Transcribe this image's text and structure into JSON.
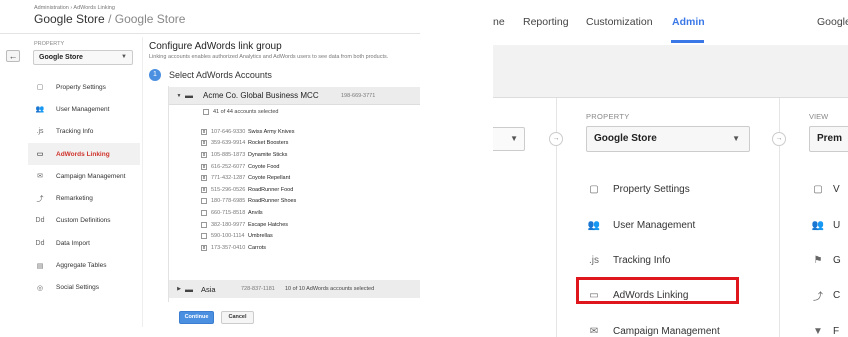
{
  "left": {
    "breadcrumb": "Administration › AdWords Linking",
    "title_main": "Google Store",
    "title_sub": "/ Google Store",
    "back_icon": "←",
    "property_label": "PROPERTY",
    "property_value": "Google Store",
    "nav": [
      {
        "label": "Property Settings",
        "icon": "▢"
      },
      {
        "label": "User Management",
        "icon": "👥"
      },
      {
        "label": "Tracking Info",
        "icon": ".js"
      },
      {
        "label": "AdWords Linking",
        "icon": "▭",
        "active": true
      },
      {
        "label": "Campaign Management",
        "icon": "✉"
      },
      {
        "label": "Remarketing",
        "icon": "⤴"
      },
      {
        "label": "Custom Definitions",
        "icon": "Dd"
      },
      {
        "label": "Data Import",
        "icon": "Dd"
      },
      {
        "label": "Aggregate Tables",
        "icon": "▤"
      },
      {
        "label": "Social Settings",
        "icon": "◎"
      }
    ],
    "config_title": "Configure AdWords link group",
    "config_desc": "Linking accounts enables authorized Analytics and AdWords users to see data from both products.",
    "step_number": "1",
    "step_label": "Select AdWords Accounts",
    "mcc": {
      "name": "Acme Co. Global Business MCC",
      "id": "198-669-3771"
    },
    "selected_text": "41 of 44 accounts selected",
    "accounts": [
      {
        "id": "107-646-9330",
        "name": "Swiss Army Knives",
        "checked": true
      },
      {
        "id": "359-639-9914",
        "name": "Rocket Boosters",
        "checked": true
      },
      {
        "id": "105-885-1873",
        "name": "Dynamite Sticks",
        "checked": true
      },
      {
        "id": "616-252-6077",
        "name": "Coyote Food",
        "checked": true
      },
      {
        "id": "771-432-1287",
        "name": "Coyote Repellant",
        "checked": true
      },
      {
        "id": "515-296-0526",
        "name": "RoadRunner Food",
        "checked": true
      },
      {
        "id": "180-778-6985",
        "name": "RoadRunner Shoes",
        "checked": false
      },
      {
        "id": "660-715-8518",
        "name": "Anvils",
        "checked": false
      },
      {
        "id": "382-180-9977",
        "name": "Escape Hatches",
        "checked": false
      },
      {
        "id": "590-100-1114",
        "name": "Umbrellas",
        "checked": false
      },
      {
        "id": "173-357-0410",
        "name": "Carrots",
        "checked": true
      }
    ],
    "asia": {
      "name": "Asia",
      "id": "728-837-1181",
      "count": "10 of 10  AdWords accounts selected"
    },
    "continue_label": "Continue",
    "cancel_label": "Cancel"
  },
  "right": {
    "tabs": [
      {
        "label": "ne",
        "active": false
      },
      {
        "label": "Reporting",
        "active": false
      },
      {
        "label": "Customization",
        "active": false
      },
      {
        "label": "Admin",
        "active": true
      },
      {
        "label": "Google",
        "active": false
      }
    ],
    "property_label": "PROPERTY",
    "property_value": "Google Store",
    "view_label": "VIEW",
    "view_value": "Prem",
    "nav": [
      {
        "label": "Property Settings",
        "icon": "▢"
      },
      {
        "label": "User Management",
        "icon": "👥"
      },
      {
        "label": "Tracking Info",
        "icon": ".js"
      },
      {
        "label": "AdWords Linking",
        "icon": "▭",
        "highlighted": true
      },
      {
        "label": "Campaign Management",
        "icon": "✉"
      }
    ],
    "view_nav": [
      {
        "label": "V",
        "icon": "▢"
      },
      {
        "label": "U",
        "icon": "👥"
      },
      {
        "label": "G",
        "icon": "⚑"
      },
      {
        "label": "C",
        "icon": "⤴"
      },
      {
        "label": "F",
        "icon": "▼"
      }
    ],
    "highlight_color": "#e0161d",
    "accent_color": "#3b78e7"
  }
}
